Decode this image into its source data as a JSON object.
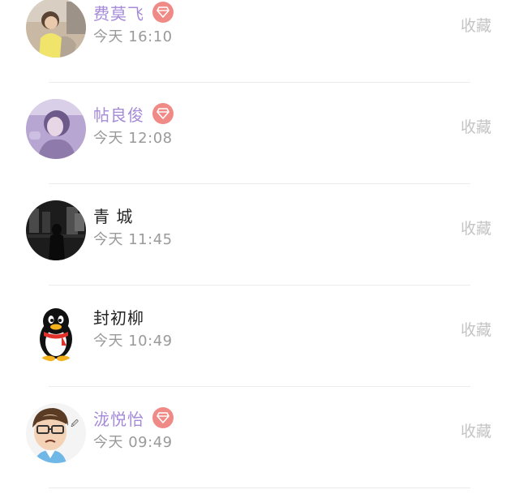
{
  "contacts": [
    {
      "name": "费莫飞",
      "time": "今天 16:10",
      "action": "收藏",
      "vip": true,
      "avatar": "photo-avatar-girl-yellow"
    },
    {
      "name": "帖良俊",
      "time": "今天 12:08",
      "action": "收藏",
      "vip": true,
      "avatar": "photo-avatar-girl-purple"
    },
    {
      "name": "青 城",
      "time": "今天 11:45",
      "action": "收藏",
      "vip": false,
      "avatar": "photo-avatar-dark-street"
    },
    {
      "name": "封初柳",
      "time": "今天 10:49",
      "action": "收藏",
      "vip": false,
      "avatar": "qq-penguin-avatar"
    },
    {
      "name": "泷悦怡",
      "time": "今天 09:49",
      "action": "收藏",
      "vip": true,
      "avatar": "cartoon-glasses-avatar"
    }
  ],
  "colors": {
    "vip_name": "#a58ad8",
    "vip_badge": "#f08a87",
    "normal_name": "#222222",
    "time": "#9a9a9a",
    "action": "#c4c4c4"
  }
}
